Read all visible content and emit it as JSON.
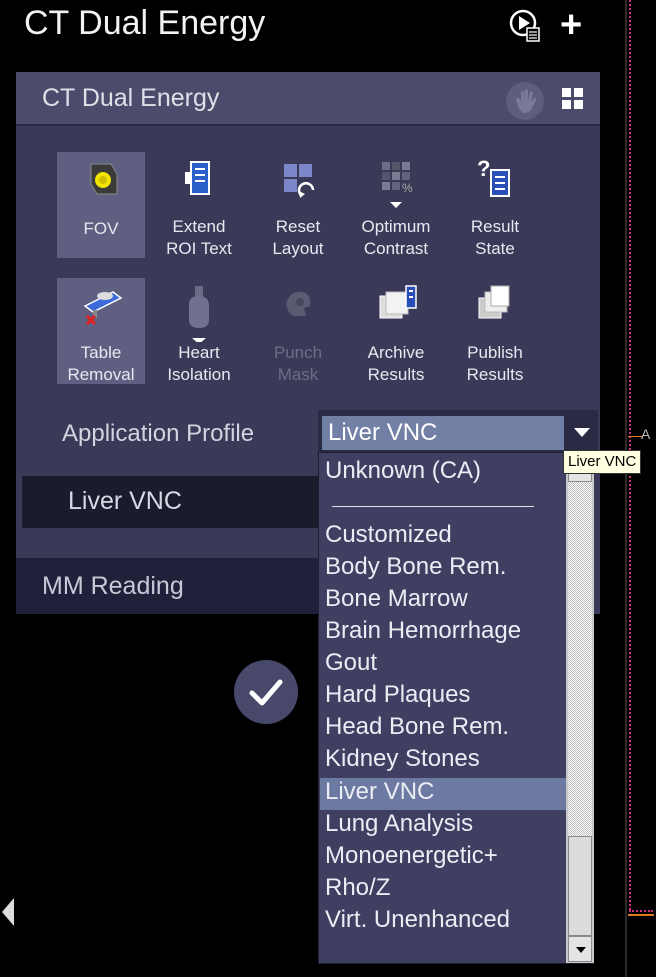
{
  "header": {
    "title": "CT Dual Energy",
    "play_icon": "play-document-icon",
    "plus_icon": "plus-icon"
  },
  "panel": {
    "title": "CT Dual Energy",
    "hand_icon": "hand-icon",
    "grid_icon": "grid-icon",
    "tools": [
      {
        "label1": "FOV",
        "label2": "",
        "icon": "fov-icon",
        "active": true,
        "disabled": false
      },
      {
        "label1": "Extend",
        "label2": "ROI Text",
        "icon": "extend-roi-text-icon",
        "active": false,
        "disabled": false
      },
      {
        "label1": "Reset",
        "label2": "Layout",
        "icon": "reset-layout-icon",
        "active": false,
        "disabled": false
      },
      {
        "label1": "Optimum",
        "label2": "Contrast",
        "icon": "optimum-contrast-icon",
        "active": false,
        "disabled": false
      },
      {
        "label1": "Result",
        "label2": "State",
        "icon": "result-state-icon",
        "active": false,
        "disabled": false
      },
      {
        "label1": "Table",
        "label2": "Removal",
        "icon": "table-removal-icon",
        "active": true,
        "disabled": false
      },
      {
        "label1": "Heart",
        "label2": "Isolation",
        "icon": "heart-isolation-icon",
        "active": false,
        "disabled": false
      },
      {
        "label1": "Punch",
        "label2": "Mask",
        "icon": "punch-mask-icon",
        "active": false,
        "disabled": true
      },
      {
        "label1": "Archive",
        "label2": "Results",
        "icon": "archive-results-icon",
        "active": false,
        "disabled": false
      },
      {
        "label1": "Publish",
        "label2": "Results",
        "icon": "publish-results-icon",
        "active": false,
        "disabled": false
      }
    ],
    "profile_label": "Application Profile",
    "profile_value": "Liver VNC",
    "tooltip": "Liver VNC",
    "liver_row": "Liver VNC",
    "mm_reading": "MM Reading"
  },
  "dropdown": {
    "items_top": [
      "Unknown (CA)"
    ],
    "items": [
      "Customized",
      "Body Bone Rem.",
      "Bone Marrow",
      "Brain Hemorrhage",
      "Gout",
      "Hard Plaques",
      "Head Bone Rem.",
      "Kidney Stones",
      "Liver VNC",
      "Lung Analysis",
      "Monoenergetic+",
      "Rho/Z",
      "Virt. Unenhanced"
    ],
    "selected": "Liver VNC"
  },
  "right_edge": {
    "letter": "A"
  },
  "colors": {
    "accent": "#7380a6",
    "panel": "#3a3a58",
    "marker": "#d0307a"
  }
}
